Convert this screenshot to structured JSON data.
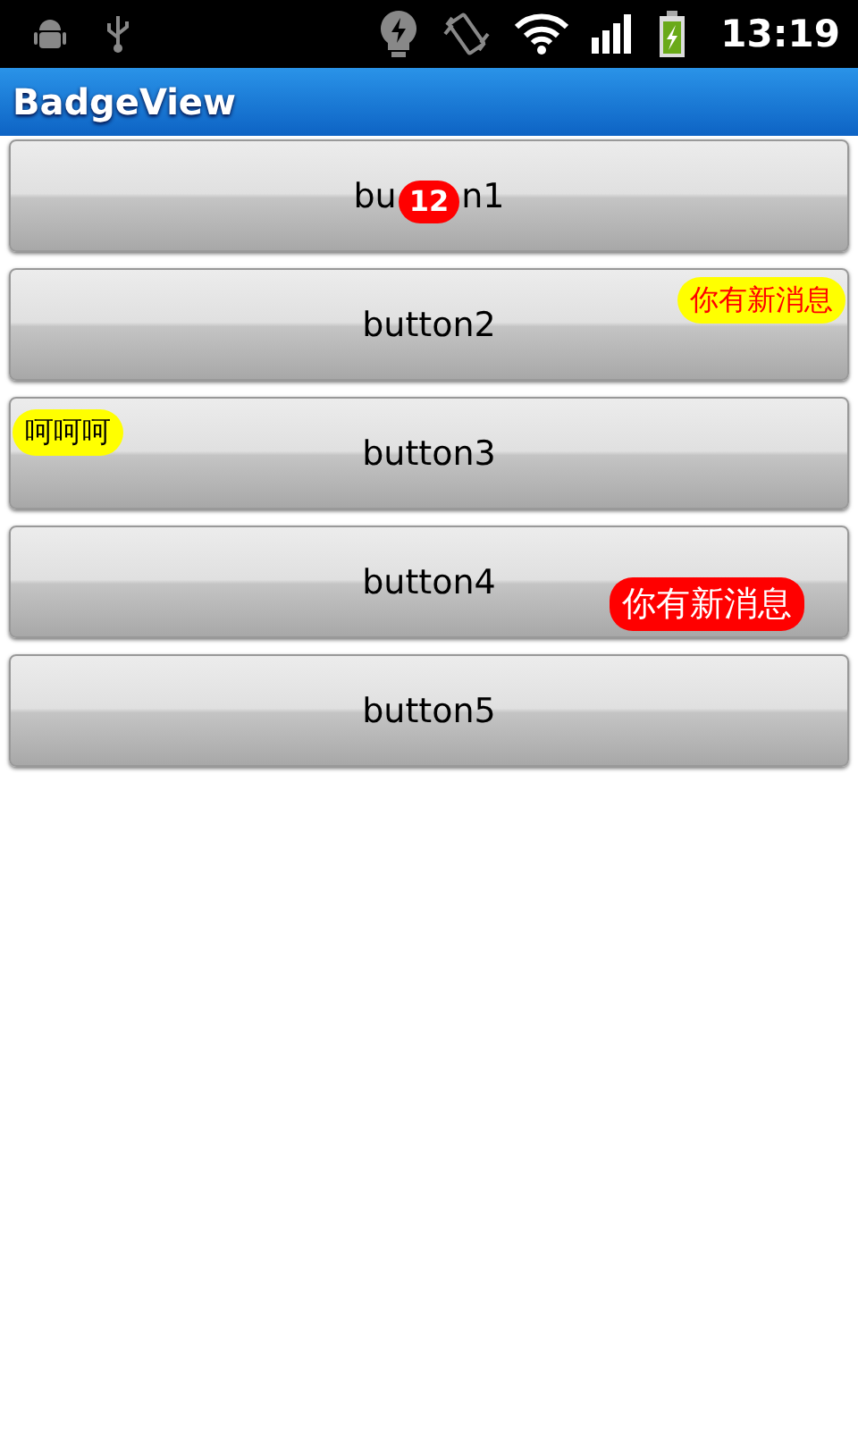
{
  "status_bar": {
    "time": "13:19"
  },
  "app_bar": {
    "title": "BadgeView"
  },
  "buttons": [
    {
      "label_parts": [
        "bu",
        "n1"
      ],
      "badge": {
        "kind": "count",
        "text": "12",
        "color": "#ff0000"
      }
    },
    {
      "label": "button2",
      "badge": {
        "kind": "note",
        "text": "你有新消息",
        "color": "#ffff00"
      }
    },
    {
      "label": "button3",
      "badge": {
        "kind": "tag",
        "text": "呵呵呵",
        "color": "#ffff00"
      }
    },
    {
      "label": "button4",
      "badge": {
        "kind": "alert",
        "text": "你有新消息",
        "color": "#ff0000"
      }
    },
    {
      "label": "button5"
    }
  ]
}
